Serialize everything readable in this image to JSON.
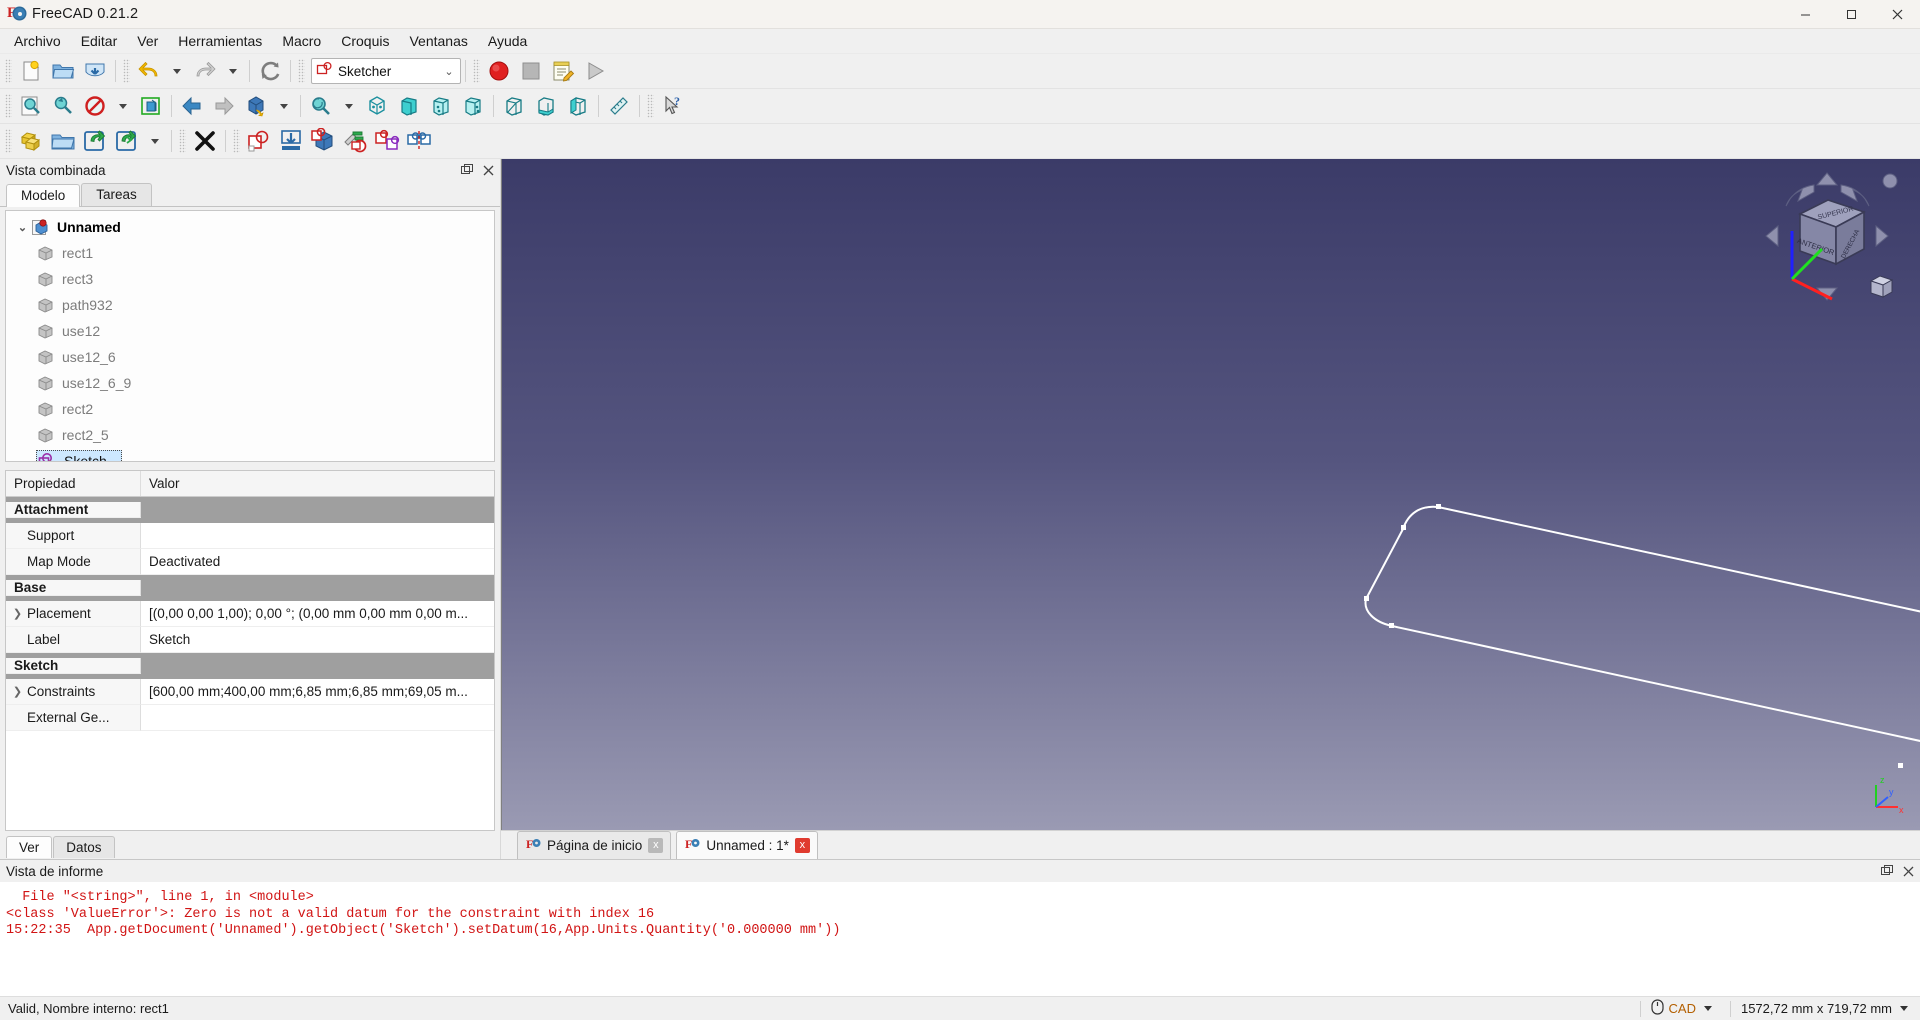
{
  "window": {
    "title": "FreeCAD 0.21.2",
    "app_icon": "freecad-logo-icon",
    "minimize_label": "Minimizar",
    "maximize_label": "Maximizar",
    "close_label": "Cerrar"
  },
  "menubar": {
    "items": [
      {
        "label": "Archivo",
        "name": "menu-archivo"
      },
      {
        "label": "Editar",
        "name": "menu-editar"
      },
      {
        "label": "Ver",
        "name": "menu-ver"
      },
      {
        "label": "Herramientas",
        "name": "menu-herramientas"
      },
      {
        "label": "Macro",
        "name": "menu-macro"
      },
      {
        "label": "Croquis",
        "name": "menu-croquis"
      },
      {
        "label": "Ventanas",
        "name": "menu-ventanas"
      },
      {
        "label": "Ayuda",
        "name": "menu-ayuda"
      }
    ]
  },
  "toolbar_file": {
    "new_label": "Nuevo",
    "open_label": "Abrir",
    "save_label": "Guardar",
    "undo_label": "Deshacer",
    "redo_label": "Rehacer",
    "refresh_label": "Actualizar"
  },
  "workbench": {
    "selected": "Sketcher",
    "icon": "sketcher-icon",
    "options": [
      "Sketcher"
    ]
  },
  "toolbar_macro": {
    "record_label": "Grabar macro",
    "stop_label": "Detener grabación",
    "edit_label": "Macros...",
    "execute_label": "Ejecutar macro"
  },
  "toolbar_view": {
    "fit_all_label": "Ajustar todo",
    "fit_selection_label": "Ajustar selección",
    "draw_style_label": "Estilo de dibujo",
    "bound_box_label": "Caja delimitadora",
    "back_label": "Vista anterior",
    "forward_label": "Vista siguiente",
    "axonometric_label": "Axonométrica",
    "zoom_label": "Zoom",
    "isometric_label": "Isométrica",
    "front_label": "Frontal",
    "top_label": "Superior",
    "right_label": "Derecha",
    "rear_label": "Posterior",
    "bottom_label": "Inferior",
    "left_label": "Izquierda",
    "measure_label": "Medir",
    "whats_this_label": "Qué es esto"
  },
  "toolbar_sketcher": {
    "create_sketch_label": "Crear croquis",
    "edit_sketch_label": "Editar croquis",
    "attach_sketch_label": "Adjuntar croquis",
    "reorient_sketch_label": "Reorientar croquis",
    "leave_sketch_label": "Salir del croquis",
    "view_sketch_label": "Ver sección",
    "view_section_label": "Ver sección",
    "map_sketch_label": "Mapear croquis a cara",
    "validate_sketch_label": "Validar croquis",
    "merge_sketches_label": "Fusionar croquis",
    "mirror_sketch_label": "Croquis simétrico"
  },
  "combined_view": {
    "title": "Vista combinada",
    "float_label": "Flotar",
    "close_label": "Cerrar",
    "tabs": [
      {
        "label": "Modelo",
        "name": "tab-modelo",
        "active": true
      },
      {
        "label": "Tareas",
        "name": "tab-tareas",
        "active": false
      }
    ],
    "tree": {
      "root": {
        "label": "Unnamed",
        "icon": "document-icon",
        "expanded": true
      },
      "children": [
        {
          "label": "rect1",
          "icon": "part-feature-icon"
        },
        {
          "label": "rect3",
          "icon": "part-feature-icon"
        },
        {
          "label": "path932",
          "icon": "part-feature-icon"
        },
        {
          "label": "use12",
          "icon": "part-feature-icon"
        },
        {
          "label": "use12_6",
          "icon": "part-feature-icon"
        },
        {
          "label": "use12_6_9",
          "icon": "part-feature-icon"
        },
        {
          "label": "rect2",
          "icon": "part-feature-icon"
        },
        {
          "label": "rect2_5",
          "icon": "part-feature-icon"
        },
        {
          "label": "Sketch",
          "icon": "sketch-icon",
          "selected": true
        }
      ]
    }
  },
  "properties": {
    "header": {
      "name_col": "Propiedad",
      "value_col": "Valor"
    },
    "rows": [
      {
        "type": "group",
        "name": "Attachment",
        "value": ""
      },
      {
        "type": "item",
        "name": "Support",
        "value": "",
        "expandable": false
      },
      {
        "type": "item",
        "name": "Map Mode",
        "value": "Deactivated",
        "expandable": false
      },
      {
        "type": "group",
        "name": "Base",
        "value": ""
      },
      {
        "type": "item",
        "name": "Placement",
        "value": "[(0,00 0,00 1,00); 0,00 °; (0,00 mm  0,00 mm  0,00 m...",
        "expandable": true
      },
      {
        "type": "item",
        "name": "Label",
        "value": "Sketch",
        "expandable": false
      },
      {
        "type": "group",
        "name": "Sketch",
        "value": ""
      },
      {
        "type": "item",
        "name": "Constraints",
        "value": "[600,00 mm;400,00 mm;6,85 mm;6,85 mm;69,05 m...",
        "expandable": true
      },
      {
        "type": "item",
        "name": "External Ge...",
        "value": "",
        "expandable": false
      }
    ],
    "bottom_tabs": [
      {
        "label": "Ver",
        "name": "tab-ver",
        "active": true
      },
      {
        "label": "Datos",
        "name": "tab-datos",
        "active": false
      }
    ]
  },
  "view3d": {
    "background_top": "#3b3b68",
    "background_bottom": "#9a9ab3",
    "sketch_color": "#ffffff",
    "navcube": {
      "faces": [
        "SUPERIOR",
        "ANTERIOR",
        "DERECHA"
      ],
      "home_label": "Vista inicial"
    },
    "axis": {
      "x": "x",
      "y": "y",
      "z": "z"
    }
  },
  "document_tabs": [
    {
      "label": "Página de inicio",
      "name": "doc-tab-start-page",
      "active": false,
      "close_label": "x"
    },
    {
      "label": "Unnamed : 1*",
      "name": "doc-tab-unnamed",
      "active": true,
      "close_label": "x"
    }
  ],
  "report_view": {
    "title": "Vista de informe",
    "float_label": "Flotar",
    "close_label": "Cerrar",
    "lines": [
      "  File \"<string>\", line 1, in <module>",
      "<class 'ValueError'>: Zero is not a valid datum for the constraint with index 16",
      "15:22:35  App.getDocument('Unnamed').getObject('Sketch').setDatum(16,App.Units.Quantity('0.000000 mm'))"
    ],
    "text_color": "#d11414"
  },
  "statusbar": {
    "message": "Valid, Nombre interno: rect1",
    "navigation_style": "CAD",
    "navigation_icon": "mouse-icon",
    "dimensions": "1572,72 mm x 719,72 mm"
  }
}
